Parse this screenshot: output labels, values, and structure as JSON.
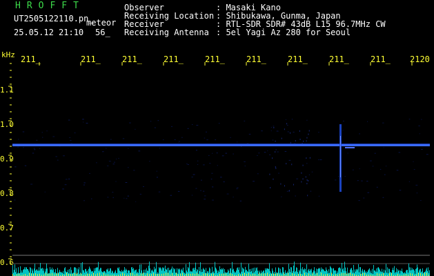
{
  "station": {
    "logo": "HROFFT",
    "filename": "UT2505122110.pn_",
    "timestamp": "25.05.12 21:10",
    "count": "56_",
    "mode": "meteor"
  },
  "info": [
    {
      "key": "Observer",
      "value": ": Masaki Kano"
    },
    {
      "key": "Receiving Location",
      "value": ": Shibukawa, Gunma, Japan"
    },
    {
      "key": "Receiver",
      "value": ": RTL-SDR SDR# 43dB L15 96.7MHz CW"
    },
    {
      "key": "Receiving Antenna",
      "value": ": 5el Yagi Az 280 for Seoul"
    }
  ],
  "axis": {
    "unit": "kHz",
    "x_ticks": [
      "211_",
      "211_",
      "211_",
      "211_",
      "211_",
      "211_",
      "211_",
      "211_",
      "211_",
      "2120"
    ],
    "y_ticks": [
      "1.1",
      "1.0",
      "0.9",
      "0.8",
      "0.7",
      "0.6"
    ]
  },
  "colors": {
    "background": "#000000",
    "carrier": "#3a6bff",
    "grid": "#0a1650",
    "label": "#ffff33",
    "noise": "#00d8d8"
  }
}
